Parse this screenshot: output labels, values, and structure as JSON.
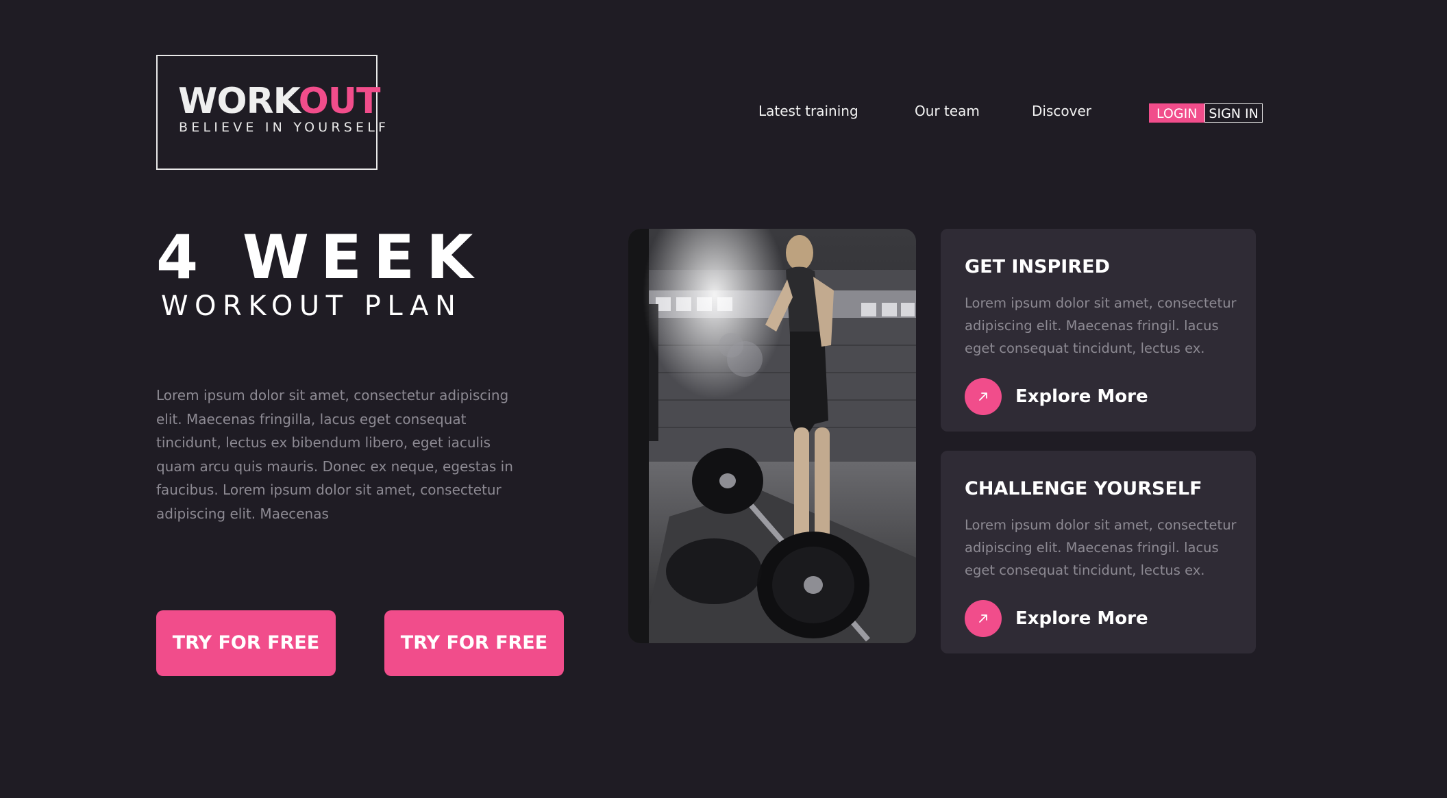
{
  "logo": {
    "word_part1": "WORK",
    "word_part2": "OUT",
    "tagline": "BELIEVE IN YOURSELF"
  },
  "nav": {
    "links": [
      "Latest training",
      "Our team",
      "Discover"
    ],
    "login": "LOGIN",
    "signin": "SIGN IN"
  },
  "hero": {
    "title": "4 WEEK",
    "subtitle": "WORKOUT PLAN",
    "text": "Lorem ipsum dolor sit amet, consectetur adipiscing elit. Maecenas fringilla, lacus eget consequat tincidunt, lectus ex bibendum libero, eget iaculis quam arcu quis mauris. Donec ex neque, egestas in faucibus. Lorem ipsum dolor sit amet, consectetur adipiscing elit. Maecenas",
    "cta_primary": "TRY FOR FREE",
    "cta_secondary": "TRY FOR FREE"
  },
  "cards": [
    {
      "title": "GET INSPIRED",
      "text": "Lorem ipsum dolor sit amet, consectetur adipiscing elit. Maecenas fringil. lacus eget consequat tincidunt, lectus ex.",
      "link": "Explore More"
    },
    {
      "title": "CHALLENGE YOURSELF",
      "text": "Lorem ipsum dolor sit amet, consectetur adipiscing elit. Maecenas fringil. lacus eget consequat tincidunt, lectus ex.",
      "link": "Explore More"
    }
  ],
  "colors": {
    "background": "#1f1c24",
    "accent": "#f14d8b",
    "card": "#2f2b35",
    "muted_text": "#8d8a93"
  },
  "icons": {
    "explore": "arrow-up-right-icon"
  }
}
